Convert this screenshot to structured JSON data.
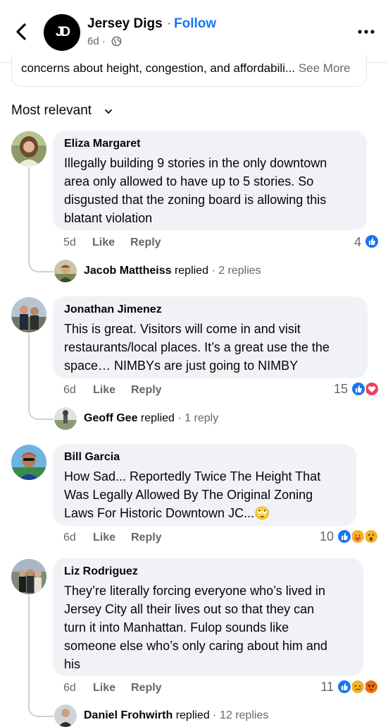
{
  "header": {
    "page_name": "Jersey Digs",
    "separator": "·",
    "follow_label": "Follow",
    "time": "6d ·",
    "logo_text": "JD"
  },
  "post_snippet": {
    "text": "concerns about height, congestion, and affordabili...",
    "see_more": "See More"
  },
  "sort": {
    "label": "Most relevant"
  },
  "comments": [
    {
      "author": "Eliza Margaret",
      "text": "Illegally building 9 stories in the only downtown\narea only allowed to have up to 5 stories. So\ndisgusted that the zoning board is allowing this\nblatant violation",
      "time": "5d",
      "like": "Like",
      "reply": "Reply",
      "reaction_count": "4",
      "reactions": [
        "like"
      ],
      "reply_author": "Jacob Mattheiss",
      "replied_word": "replied",
      "reply_count": "· 2 replies"
    },
    {
      "author": "Jonathan Jimenez",
      "text": "This is great. Visitors will come in and visit\nrestaurants/local places. It’s a great use the the\nspace… NIMBYs are just going to NIMBY",
      "time": "6d",
      "like": "Like",
      "reply": "Reply",
      "reaction_count": "15",
      "reactions": [
        "like",
        "love"
      ],
      "reply_author": "Geoff Gee",
      "replied_word": "replied",
      "reply_count": "· 1 reply"
    },
    {
      "author": "Bill Garcia",
      "text": "How Sad... Reportedly Twice The Height That\nWas Legally Allowed By The Original Zoning\nLaws For Historic Downtown JC...🙄",
      "time": "6d",
      "like": "Like",
      "reply": "Reply",
      "reaction_count": "10",
      "reactions": [
        "like",
        "care",
        "wow"
      ],
      "reply_author": "",
      "replied_word": "",
      "reply_count": ""
    },
    {
      "author": "Liz Rodriguez",
      "text": "They’re literally forcing everyone who’s lived in\nJersey City all their lives out so that they can\nturn it into Manhattan. Fulop sounds like\nsomeone else who’s only caring about him and\nhis",
      "time": "6d",
      "like": "Like",
      "reply": "Reply",
      "reaction_count": "11",
      "reactions": [
        "like",
        "sad",
        "angry"
      ],
      "reply_author": "Daniel Frohwirth",
      "replied_word": "replied",
      "reply_count": "· 12 replies"
    }
  ],
  "colors": {
    "accent": "#1877f2",
    "like": "#1877f2",
    "love": "#f33e58",
    "emoji": "#f7b125",
    "angry": "#e9710f",
    "bubble": "#f0f2f5",
    "secondary_text": "#65676b"
  },
  "icons": {
    "back": "chevron-left-icon",
    "globe": "globe-icon",
    "more": "more-horizontal-icon",
    "sort": "chevron-down-icon"
  }
}
